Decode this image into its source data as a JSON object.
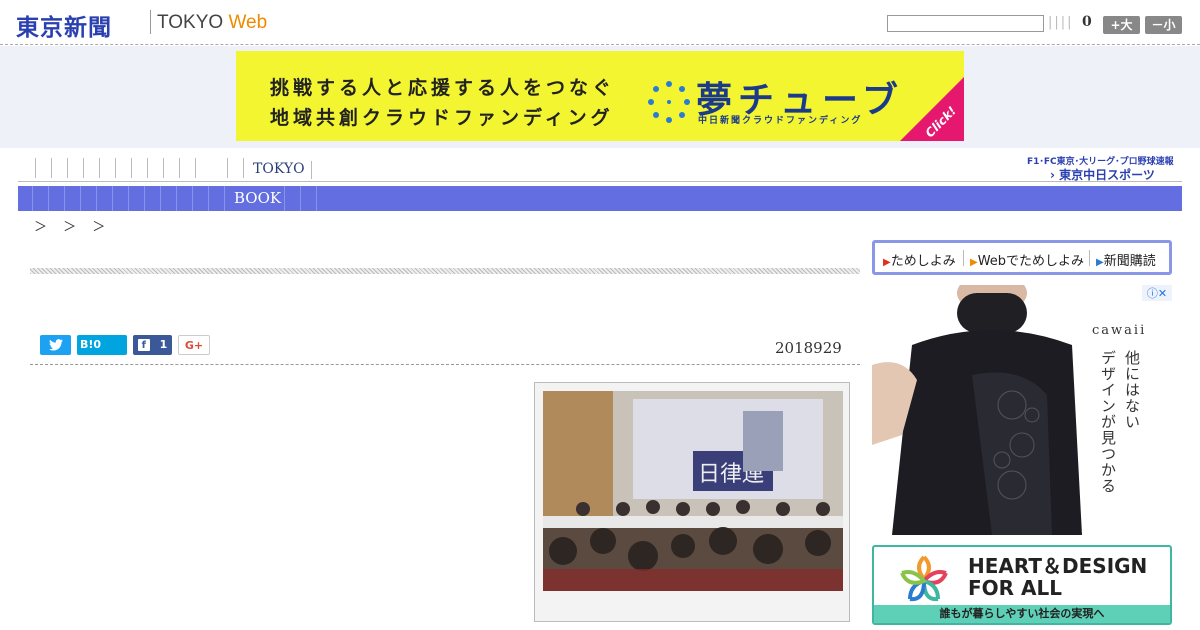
{
  "header": {
    "logo_jp": "東京新聞",
    "logo_en_a": "TOKYO",
    "logo_en_b": "Web",
    "counter": "0",
    "font_larger": "+大",
    "font_smaller": "－小"
  },
  "banner": {
    "line1": "挑戦する人と応援する人をつなぐ",
    "line2": "地域共創クラウドファンディング",
    "brand": "夢チューブ",
    "brand_sub": "中日新聞クラウドファンディング",
    "click": "Click!"
  },
  "nav": {
    "tokyo": "TOKYO",
    "chunichi_line1": "F1･FC東京･大リーグ･プロ野球速報",
    "chunichi_line2": "東京中日スポーツ",
    "book": "BOOK"
  },
  "breadcrumb": "＞ ＞ ＞",
  "article": {
    "date": "2018929",
    "share_fb_count": "1",
    "share_hatena": "B!0",
    "share_gplus": "G+"
  },
  "sidebar": {
    "tabs": [
      "ためしよみ",
      "Webでためしよみ",
      "新聞購読"
    ],
    "ad1": {
      "brand": "cawaii",
      "copy_col1": "他にはない",
      "copy_col2": "デザインが見つかる"
    },
    "ad2": {
      "title1": "HEART＆DESIGN",
      "title2": "FOR ALL",
      "caption": "誰もが暮らしやすい社会の実現へ"
    }
  },
  "colors": {
    "nav_blue": "#636ee0",
    "logo_blue": "#2a3fb0",
    "banner_yellow": "#f3f530",
    "twitter": "#1da1f2",
    "hatena": "#00a4de",
    "facebook": "#3b5998"
  }
}
